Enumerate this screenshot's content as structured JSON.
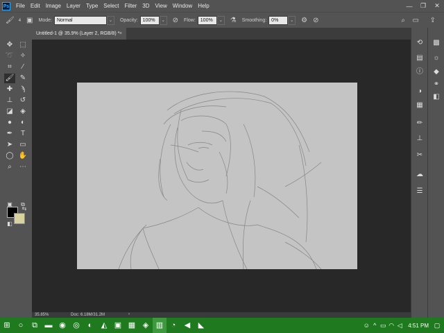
{
  "menubar": {
    "logo": "Ps",
    "items": [
      "File",
      "Edit",
      "Image",
      "Layer",
      "Type",
      "Select",
      "Filter",
      "3D",
      "View",
      "Window",
      "Help"
    ]
  },
  "optionsbar": {
    "brush_size": "4",
    "mode_label": "Mode:",
    "mode_value": "Normal",
    "opacity_label": "Opacity:",
    "opacity_value": "100%",
    "flow_label": "Flow:",
    "flow_value": "100%",
    "smoothing_label": "Smoothing:",
    "smoothing_value": "0%"
  },
  "document": {
    "tab_title": "Untitled-1 @ 35.9% (Layer 2, RGB/8) *",
    "close_glyph": "×"
  },
  "status": {
    "zoom": "35.85%",
    "doc_size": "Doc: 6.18M/31.2M",
    "arrow": "›"
  },
  "taskbar": {
    "time": "4:51 PM"
  },
  "colors": {
    "foreground": "#000000",
    "background": "#d8d2a0",
    "canvas": "#c4c4c4",
    "taskbar": "#1f7a1f"
  }
}
